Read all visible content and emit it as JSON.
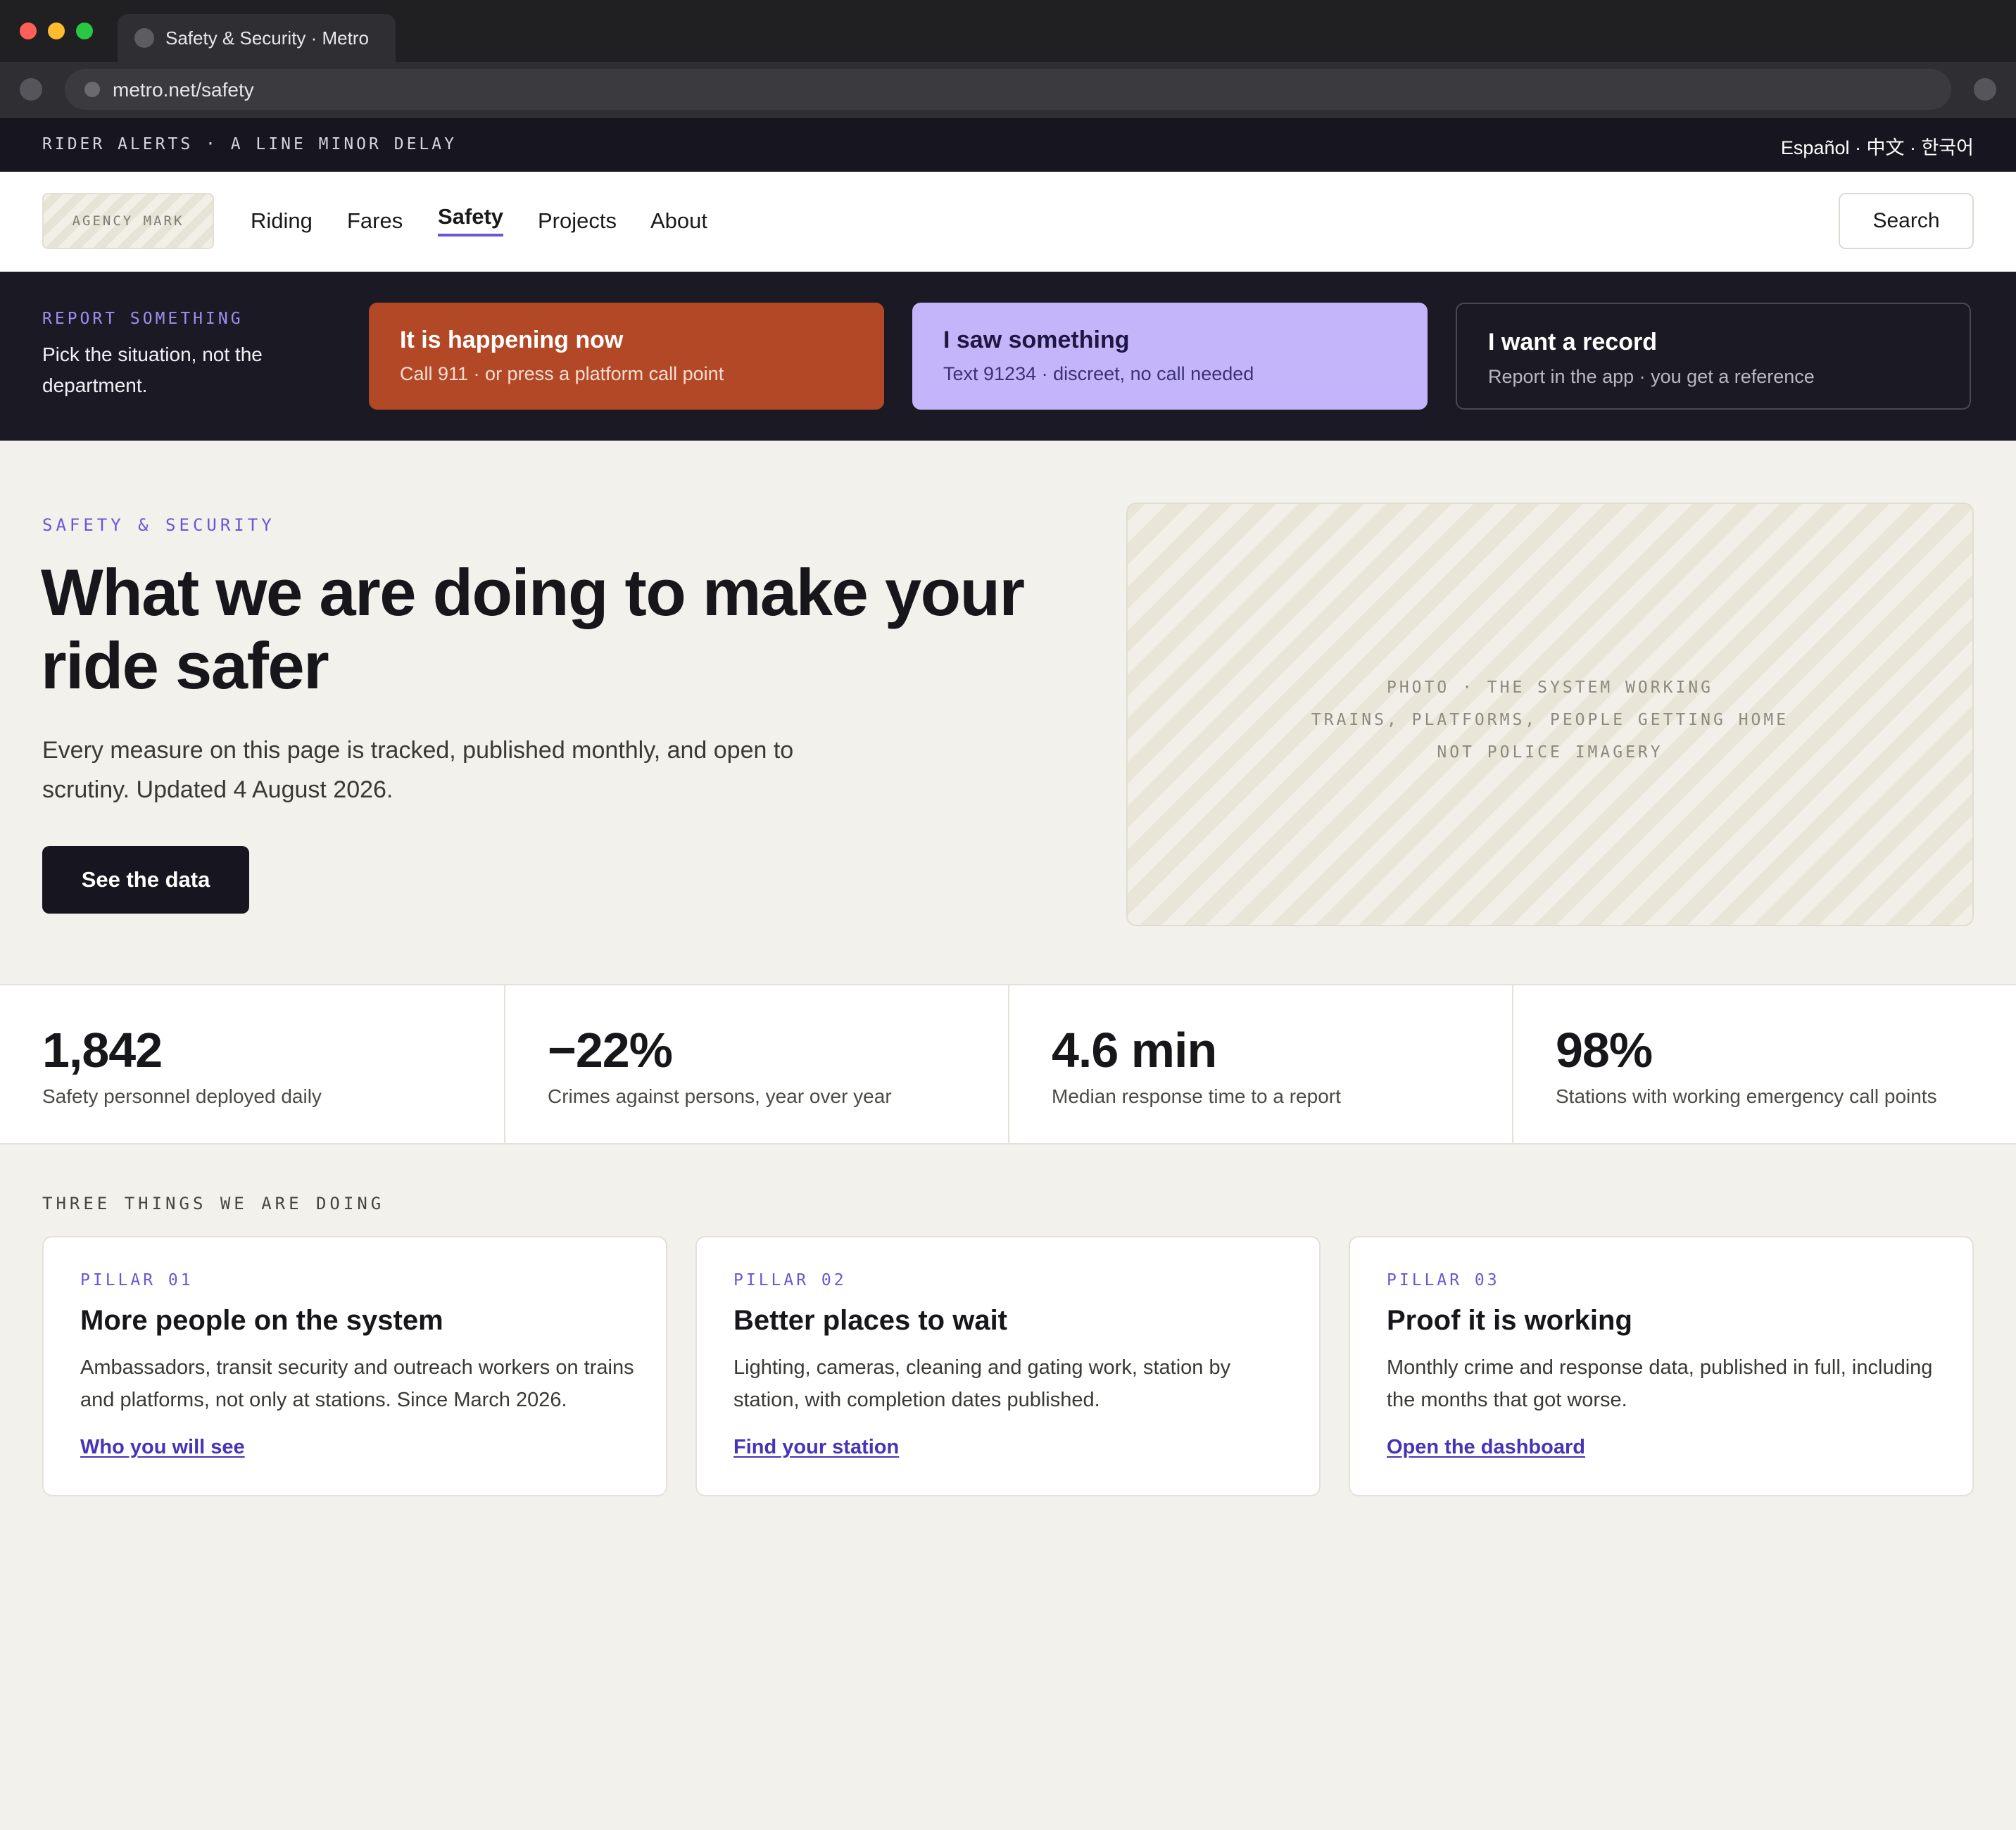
{
  "browser": {
    "tab_title": "Safety & Security · Metro",
    "url": "metro.net/safety"
  },
  "alert_bar": {
    "text": "RIDER ALERTS · A LINE MINOR DELAY",
    "languages": "Español · 中文 · 한국어"
  },
  "nav": {
    "logo_text": "AGENCY MARK",
    "items": [
      {
        "label": "Riding",
        "active": false
      },
      {
        "label": "Fares",
        "active": false
      },
      {
        "label": "Safety",
        "active": true
      },
      {
        "label": "Projects",
        "active": false
      },
      {
        "label": "About",
        "active": false
      }
    ],
    "search_label": "Search"
  },
  "report": {
    "eyebrow": "REPORT SOMETHING",
    "description": "Pick the situation, not the department.",
    "options": [
      {
        "title": "It is happening now",
        "subtitle": "Call 911 · or press a platform call point",
        "color": "#b34826"
      },
      {
        "title": "I saw something",
        "subtitle": "Text 91234 · discreet, no call needed",
        "color": "#c4b5fb"
      },
      {
        "title": "I want a record",
        "subtitle": "Report in the app · you get a reference",
        "color": "#1b1924"
      }
    ]
  },
  "hero": {
    "eyebrow": "SAFETY & SECURITY",
    "title": "What we are doing to make your ride safer",
    "lede": "Every measure on this page is tracked, published monthly, and open to scrutiny. Updated 4 August 2026.",
    "cta_label": "See the data",
    "photo_caption": [
      "PHOTO · THE SYSTEM WORKING",
      "TRAINS, PLATFORMS, PEOPLE GETTING HOME",
      "NOT POLICE IMAGERY"
    ]
  },
  "stats": [
    {
      "value": "1,842",
      "label": "Safety personnel deployed daily"
    },
    {
      "value": "−22%",
      "label": "Crimes against persons, year over year"
    },
    {
      "value": "4.6 min",
      "label": "Median response time to a report"
    },
    {
      "value": "98%",
      "label": "Stations with working emergency call points"
    }
  ],
  "pillars": {
    "eyebrow": "THREE THINGS WE ARE DOING",
    "items": [
      {
        "eyebrow": "PILLAR 01",
        "title": "More people on the system",
        "body": "Ambassadors, transit security and outreach workers on trains and platforms, not only at stations. Since March 2026.",
        "link": "Who you will see"
      },
      {
        "eyebrow": "PILLAR 02",
        "title": "Better places to wait",
        "body": "Lighting, cameras, cleaning and gating work, station by station, with completion dates published.",
        "link": "Find your station"
      },
      {
        "eyebrow": "PILLAR 03",
        "title": "Proof it is working",
        "body": "Monthly crime and response data, published in full, including the months that got worse.",
        "link": "Open the dashboard"
      }
    ]
  },
  "colors": {
    "accent": "#6a55d6",
    "dark": "#17151f",
    "urgent": "#b34826",
    "lavender": "#c4b5fb",
    "page_bg": "#f2f1ec"
  }
}
